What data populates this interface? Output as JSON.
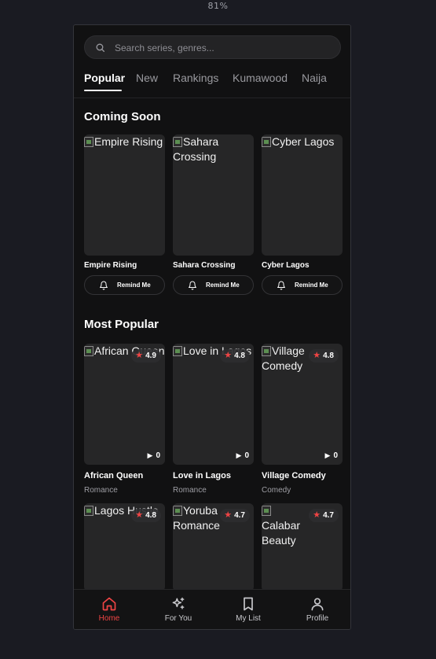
{
  "zoom_label": "81%",
  "search": {
    "placeholder": "Search series, genres..."
  },
  "tabs": [
    {
      "label": "Popular",
      "active": true
    },
    {
      "label": "New"
    },
    {
      "label": "Rankings"
    },
    {
      "label": "Kumawood"
    },
    {
      "label": "Naija"
    }
  ],
  "coming_soon": {
    "title": "Coming Soon",
    "remind_label": "Remind Me",
    "items": [
      {
        "title": "Empire Rising",
        "alt": "Empire Rising"
      },
      {
        "title": "Sahara Crossing",
        "alt": "Sahara Crossing"
      },
      {
        "title": "Cyber Lagos",
        "alt": "Cyber Lagos"
      }
    ]
  },
  "most_popular": {
    "title": "Most Popular",
    "items": [
      {
        "title": "African Queen",
        "alt": "African Queen",
        "genre": "Romance",
        "rating": "4.9",
        "views": "0"
      },
      {
        "title": "Love in Lagos",
        "alt": "Love in Lagos",
        "genre": "Romance",
        "rating": "4.8",
        "views": "0"
      },
      {
        "title": "Village Comedy",
        "alt": "Village Comedy",
        "genre": "Comedy",
        "rating": "4.8",
        "views": "0"
      },
      {
        "alt": "Lagos Hustle",
        "rating": "4.8"
      },
      {
        "alt": "Yoruba Romance",
        "rating": "4.7"
      },
      {
        "alt": "Calabar Beauty",
        "rating": "4.7"
      }
    ]
  },
  "bottom_nav": [
    {
      "label": "Home",
      "icon": "home-icon",
      "active": true
    },
    {
      "label": "For You",
      "icon": "sparkles-icon"
    },
    {
      "label": "My List",
      "icon": "bookmark-icon"
    },
    {
      "label": "Profile",
      "icon": "user-icon"
    }
  ],
  "colors": {
    "accent": "#ef4444",
    "background": "#111112",
    "card": "#262627"
  }
}
